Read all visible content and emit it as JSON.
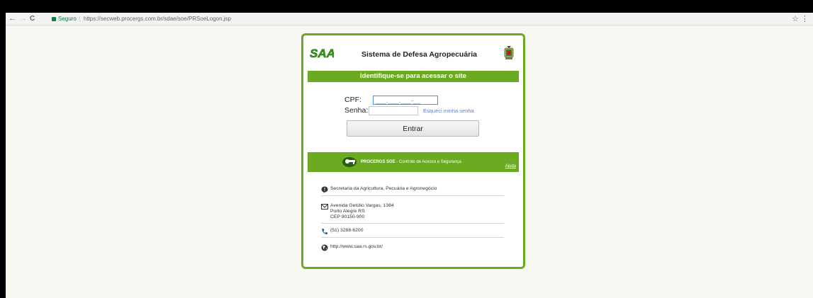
{
  "browser": {
    "secure_label": "Seguro",
    "url": "https://secweb.procergs.com.br/sdae/soe/PRSoeLogon.jsp",
    "back_glyph": "←",
    "forward_glyph": "→",
    "reload_glyph": "C",
    "star_glyph": "☆",
    "menu_glyph": "⋮"
  },
  "header": {
    "logo_text": "SAA",
    "system_title": "Sistema de Defesa Agropecuária"
  },
  "login": {
    "banner": "Identifique-se para acessar o site",
    "cpf_label": "CPF:",
    "cpf_value": "___.___.___-__",
    "senha_label": "Senha:",
    "senha_value": "",
    "forgot_link": "Esqueci minha senha",
    "submit_label": "Entrar"
  },
  "procergs_bar": {
    "brand": "PROCERGS SOE",
    "tagline": " - Controle de Acesso e Segurança",
    "help_link": "Ajuda"
  },
  "contact": {
    "agency": "Secretaria da Agricultura, Pecuária e Agronegócio",
    "address_line1": "Avenida Getúlio Vargas, 1384",
    "address_line2": "Porto Alegre RS",
    "address_line3": "CEP 90150-900",
    "phone": "(51) 3288-6200",
    "website": "http://www.saa.rs.gov.br/"
  },
  "colors": {
    "accent": "#6aab22",
    "link": "#5a7fc4",
    "background": "#f7f8f1"
  }
}
